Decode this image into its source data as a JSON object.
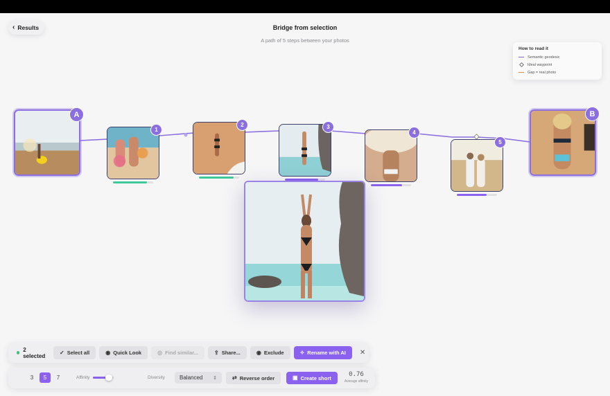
{
  "header": {
    "back_label": "Results",
    "title": "Bridge from selection",
    "subtitle": "A path of 5 steps between your photos"
  },
  "legend": {
    "title": "How to read it",
    "items": [
      {
        "label": "Semantic geodesic",
        "color": "#7b6ee8"
      },
      {
        "label": "Ideal waypoint"
      },
      {
        "label": "Gap = real photo",
        "color": "#f08a3a"
      }
    ]
  },
  "path": {
    "endpoint_a": "A",
    "endpoint_b": "B",
    "waypoints": [
      {
        "label": "1",
        "affinity": 0.85,
        "color": "#3ec99a"
      },
      {
        "label": "2",
        "affinity": 0.86,
        "color": "#3ec99a"
      },
      {
        "label": "3",
        "affinity": 0.82,
        "color": "#8b62f0"
      },
      {
        "label": "4",
        "affinity": 0.78,
        "color": "#8b62f0"
      },
      {
        "label": "5",
        "affinity": 0.74,
        "color": "#8b62f0"
      }
    ]
  },
  "selection_bar": {
    "count": "2 selected",
    "select_all": "Select all",
    "quick_look": "Quick Look",
    "find_similar": "Find similar...",
    "share": "Share...",
    "exclude": "Exclude",
    "rename": "Rename with AI"
  },
  "controls": {
    "steps": [
      "3",
      "5",
      "7"
    ],
    "steps_selected": "5",
    "affinity_label": "Affinity",
    "affinity_level": 0.75,
    "diversity_label": "Diversity",
    "diversity_value": "Balanced",
    "reverse": "Reverse order",
    "create": "Create short",
    "avg_affinity": "0.76",
    "avg_affinity_caption": "Average affinity"
  },
  "colors": {
    "accent": "#8b62f0",
    "path_line": "#8b6fe0",
    "good": "#3ec99a"
  }
}
